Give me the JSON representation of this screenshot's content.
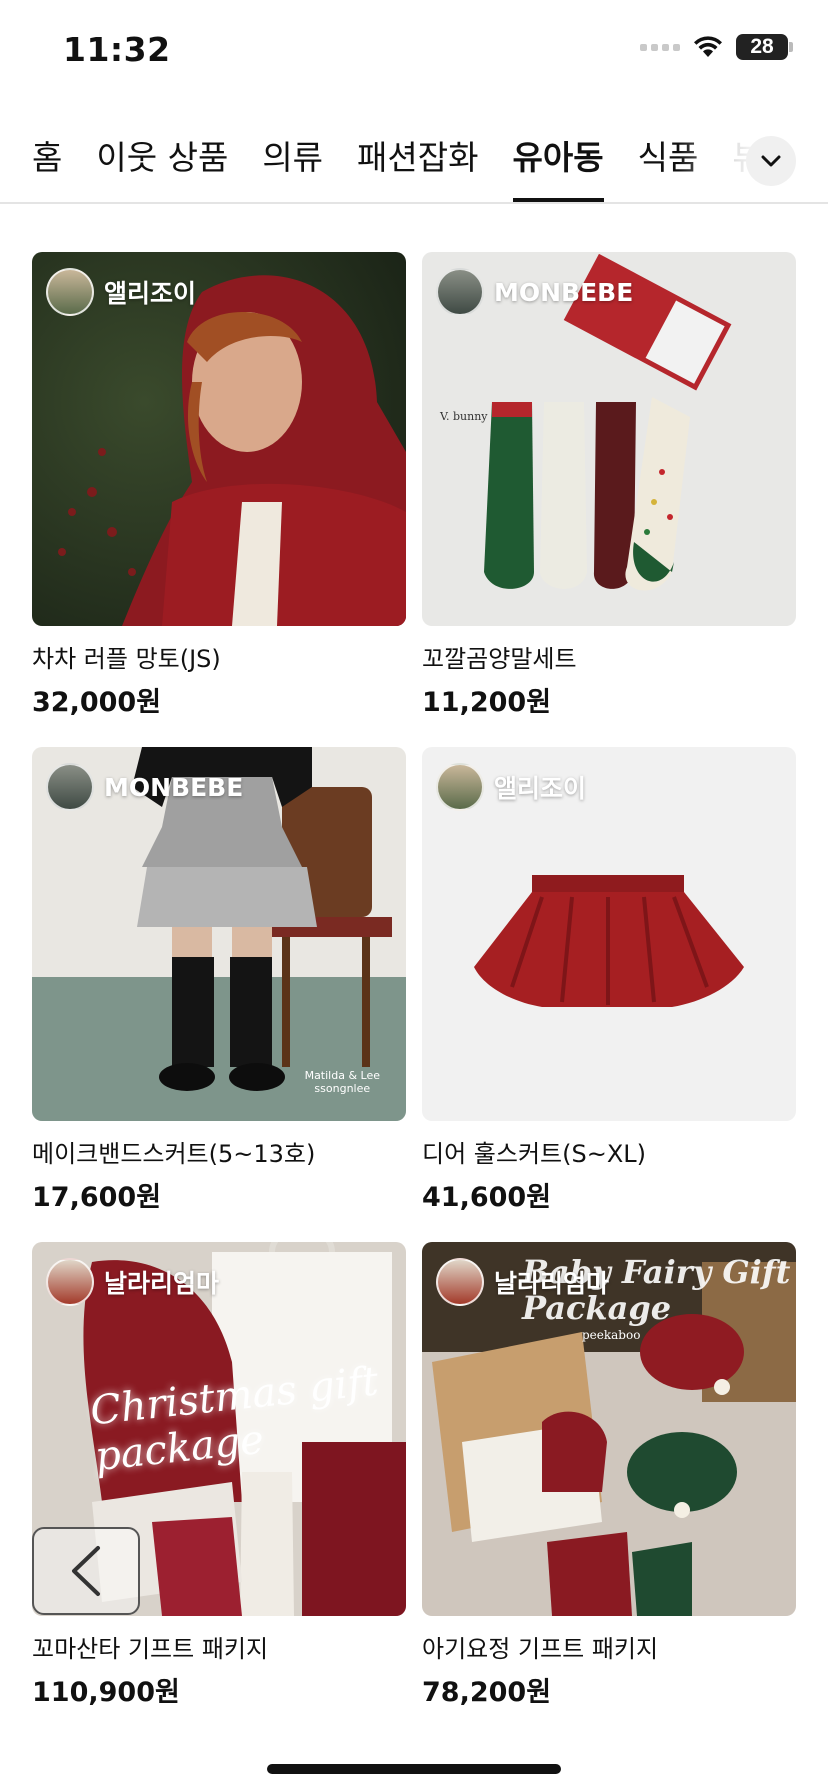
{
  "status_bar": {
    "time": "11:32",
    "battery": "28",
    "wifi_icon": "wifi-icon",
    "signal_icon": "cellular-signal-icon"
  },
  "tabs": [
    {
      "label": "홈",
      "active": false
    },
    {
      "label": "이웃 상품",
      "active": false
    },
    {
      "label": "의류",
      "active": false
    },
    {
      "label": "패션잡화",
      "active": false
    },
    {
      "label": "유아동",
      "active": true
    },
    {
      "label": "식품",
      "active": false
    },
    {
      "label": "뷰티",
      "active": false
    }
  ],
  "tab_expand_icon": "chevron-down-icon",
  "products": [
    {
      "seller": "앨리조이",
      "title": "차차 러플 망토(JS)",
      "price": "32,000원"
    },
    {
      "seller": "MONBEBE",
      "title": "꼬깔곰양말세트",
      "price": "11,200원",
      "image_text": "V. bunny"
    },
    {
      "seller": "MONBEBE",
      "title": "메이크밴드스커트(5~13호)",
      "price": "17,600원",
      "image_text": "Matilda & Lee\nssongnlee"
    },
    {
      "seller": "앨리조이",
      "title": "디어 훌스커트(S~XL)",
      "price": "41,600원"
    },
    {
      "seller": "날라리엄마",
      "title": "꼬마산타 기프트 패키지",
      "price": "110,900원",
      "image_text": "Christmas gift package"
    },
    {
      "seller": "날라리엄마",
      "title": "아기요정 기프트 패키지",
      "price": "78,200원",
      "image_text": "Baby Fairy Gift Package",
      "image_subtext": "peekaboo"
    }
  ],
  "back_button_icon": "chevron-left-icon",
  "colors": {
    "accent": "#111111",
    "tab_divider": "#e4e4e4",
    "red_product": "#9c1c22",
    "green_product": "#1f5a32"
  }
}
